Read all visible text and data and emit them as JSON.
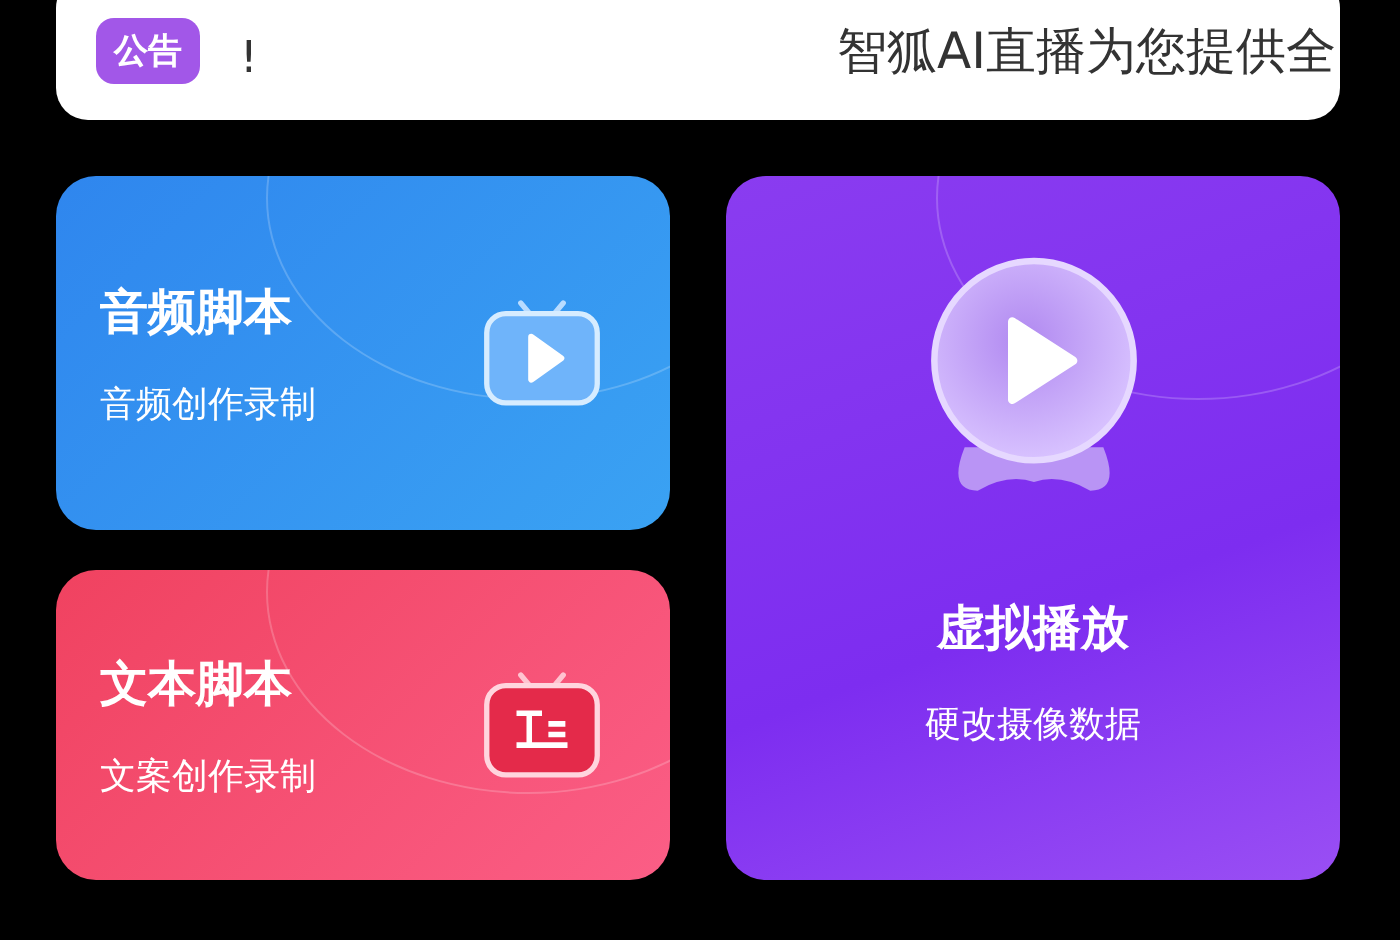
{
  "notice": {
    "badge": "公告",
    "fragments": [
      "!",
      "智狐AI直播为您提供全"
    ]
  },
  "cards": [
    {
      "kind": "audio",
      "title": "音频脚本",
      "subtitle": "音频创作录制"
    },
    {
      "kind": "virtual",
      "title": "虚拟播放",
      "subtitle": "硬改摄像数据"
    },
    {
      "kind": "text",
      "title": "文本脚本",
      "subtitle": "文案创作录制"
    }
  ]
}
